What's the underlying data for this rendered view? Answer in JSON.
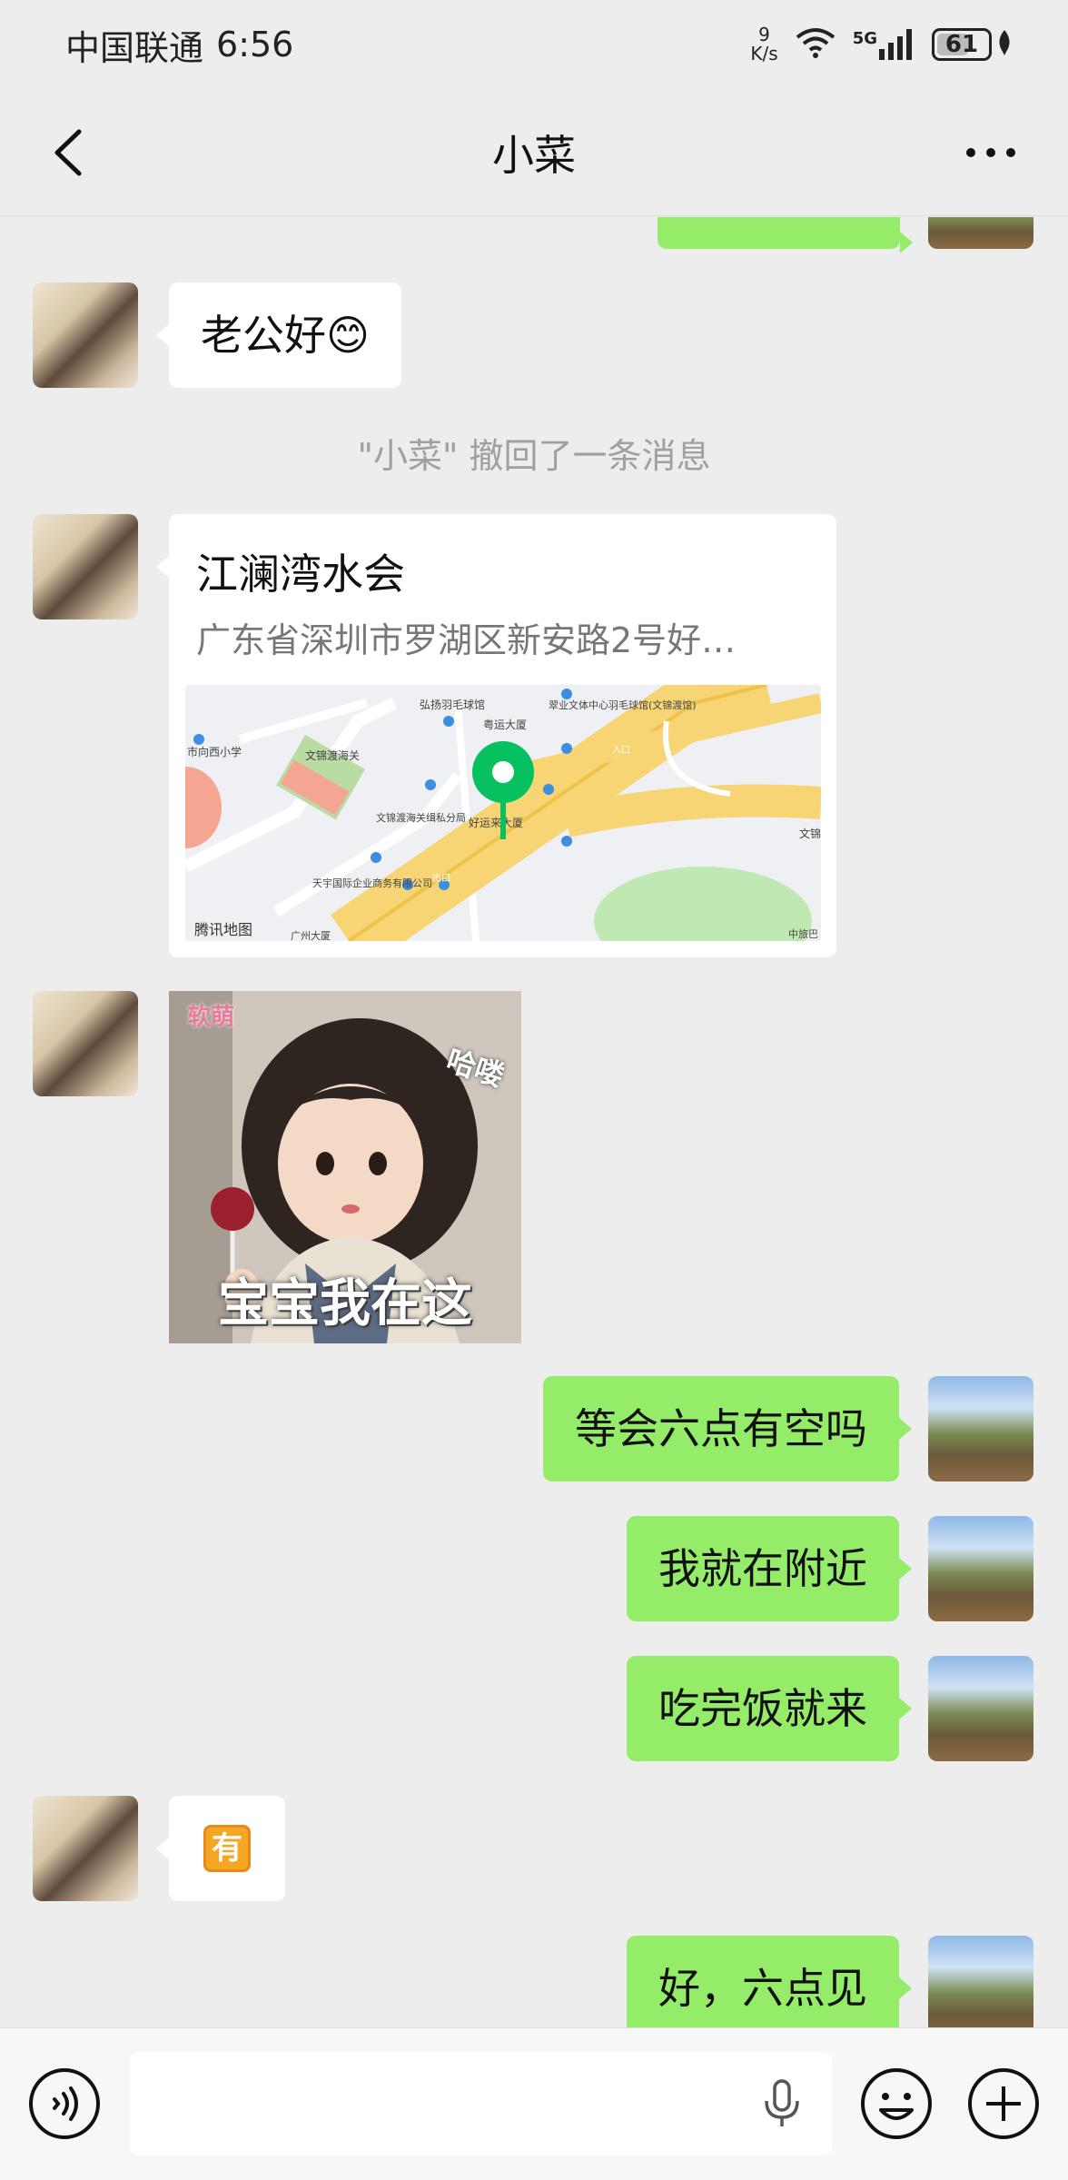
{
  "status_bar": {
    "carrier": "中国联通",
    "time": "6:56",
    "net_speed_value": "9",
    "net_speed_unit": "K/s",
    "network": "5G",
    "battery": "61"
  },
  "header": {
    "title": "小菜"
  },
  "messages": {
    "greeting": "老公好😊",
    "recall_notice": "\"小菜\" 撤回了一条消息",
    "location": {
      "name": "江澜湾水会",
      "address": "广东省深圳市罗湖区新安路2号好…",
      "map_labels": {
        "school": "市向西小学",
        "badminton": "弘扬羽毛球馆",
        "building": "粤运大厦",
        "sports": "翠业文体中心羽毛球馆(文锦渡馆)",
        "customs": "文锦渡海关",
        "customs_sub": "文锦渡海关缉私分局",
        "haoyun": "好运来大厦",
        "tianyu": "天宇国际企业商务有限公司",
        "guangzhou": "广州大厦",
        "entrance": "入口",
        "exit": "出口",
        "wenjin": "文锦管",
        "zhongluo": "中旅巴",
        "provider": "腾讯地图"
      }
    },
    "sticker": {
      "caption": "宝宝我在这",
      "hello": "哈喽",
      "corner": "软萌"
    },
    "out1": "等会六点有空吗",
    "out2": "我就在附近",
    "out3": "吃完饭就来",
    "reply_badge": "有",
    "out4": "好，六点见"
  },
  "colors": {
    "outgoing_bubble": "#95ec69",
    "incoming_bubble": "#ffffff",
    "background": "#ededed",
    "pin": "#07c160"
  }
}
